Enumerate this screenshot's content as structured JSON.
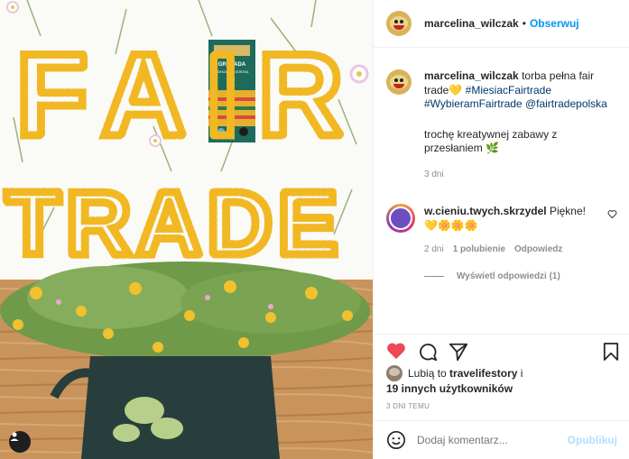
{
  "post": {
    "username": "marcelina_wilczak",
    "dot": "•",
    "follow_label": "Obserwuj"
  },
  "caption": {
    "username": "marcelina_wilczak",
    "text_part1": "torba pełna fair trade",
    "emoji_heart": "💛",
    "hashtag1": "#MiesiacFairtrade",
    "hashtag2": "#WybieramFairtrade",
    "mention": "@fairtradepolska",
    "text_part2": "trochę kreatywnej zabawy z przesłaniem",
    "emoji_leaf": "🌿",
    "time": "3 dni"
  },
  "comment": {
    "username": "w.cieniu.twych.skrzydel",
    "text": "Piękne!",
    "emojis": "💛🌼🌼🌼",
    "time": "2 dni",
    "likes": "1 polubienie",
    "reply": "Odpowiedz",
    "view_replies": "Wyświetl odpowiedzi (1)"
  },
  "likes": {
    "prefix": "Lubią to",
    "user": "travelifestory",
    "conj": "i",
    "others": "19 innych użytkowników"
  },
  "timestamp": "3 DNI TEMU",
  "add_comment": {
    "placeholder": "Dodaj komentarz...",
    "publish_label": "Opublikuj"
  },
  "photo": {
    "word1": "FAIR",
    "word2": "TRADE",
    "package_brand": "GRENADA",
    "package_subtitle": "CZEKOLADA GORZKA"
  },
  "colors": {
    "link": "#0095f6",
    "heart": "#ed4956",
    "hashtag": "#00376b",
    "muted": "#8e8e8e"
  }
}
